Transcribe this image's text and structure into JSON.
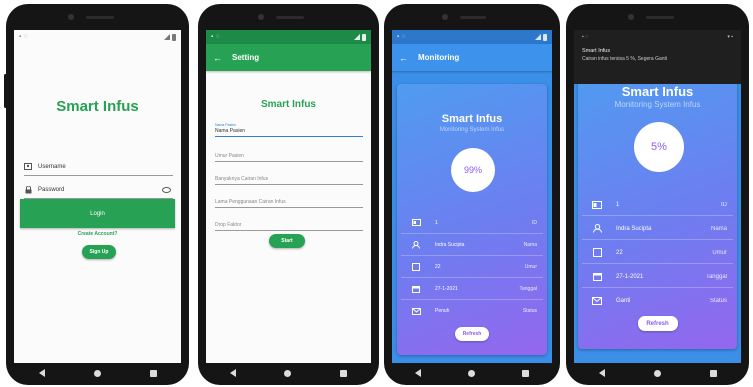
{
  "colors": {
    "green": "#27a255",
    "blue": "#3d93ec",
    "purple": "#8b5cf6"
  },
  "login": {
    "title": "Smart Infus",
    "username_placeholder": "Username",
    "password_placeholder": "Password",
    "login_label": "Login",
    "create_account": "Create Account?",
    "signup_label": "Sign Up"
  },
  "setting": {
    "appbar_title": "Setting",
    "title": "Smart Infus",
    "fields": [
      {
        "float_label": "Nama Pasien",
        "value": "Nama Pasien"
      },
      {
        "placeholder": "Umur Pasien"
      },
      {
        "placeholder": "Banyaknya Cairan Infus"
      },
      {
        "placeholder": "Lama Penggunaan Cairan Infus"
      },
      {
        "placeholder": "Drop Faktor"
      }
    ],
    "start_label": "Start"
  },
  "monitor1": {
    "appbar_title": "Monitoring",
    "title": "Smart Infus",
    "subtitle": "Monitoring System Infus",
    "percent": "99%",
    "rows": [
      {
        "icon": "id-card-icon",
        "value": "1",
        "key": "ID"
      },
      {
        "icon": "person-icon",
        "value": "Indra Sucipta",
        "key": "Nama"
      },
      {
        "icon": "square-icon",
        "value": "22",
        "key": "Umur"
      },
      {
        "icon": "calendar-icon",
        "value": "27-1-2021",
        "key": "Tanggal"
      },
      {
        "icon": "envelope-icon",
        "value": "Penuh",
        "key": "Status"
      }
    ],
    "refresh_label": "Refresh"
  },
  "monitor2": {
    "notif_app": "Smart Infus",
    "notif_body": "Cairan infus tersisa 5 %, Segera Ganti",
    "title": "Smart Infus",
    "subtitle": "Monitoring System Infus",
    "percent": "5%",
    "rows": [
      {
        "icon": "id-card-icon",
        "value": "1",
        "key": "ID"
      },
      {
        "icon": "person-icon",
        "value": "Indra Sucipta",
        "key": "Nama"
      },
      {
        "icon": "square-icon",
        "value": "22",
        "key": "Umur"
      },
      {
        "icon": "calendar-icon",
        "value": "27-1-2021",
        "key": "Tanggal"
      },
      {
        "icon": "envelope-icon",
        "value": "Ganti",
        "key": "Status"
      }
    ],
    "refresh_label": "Refresh"
  }
}
